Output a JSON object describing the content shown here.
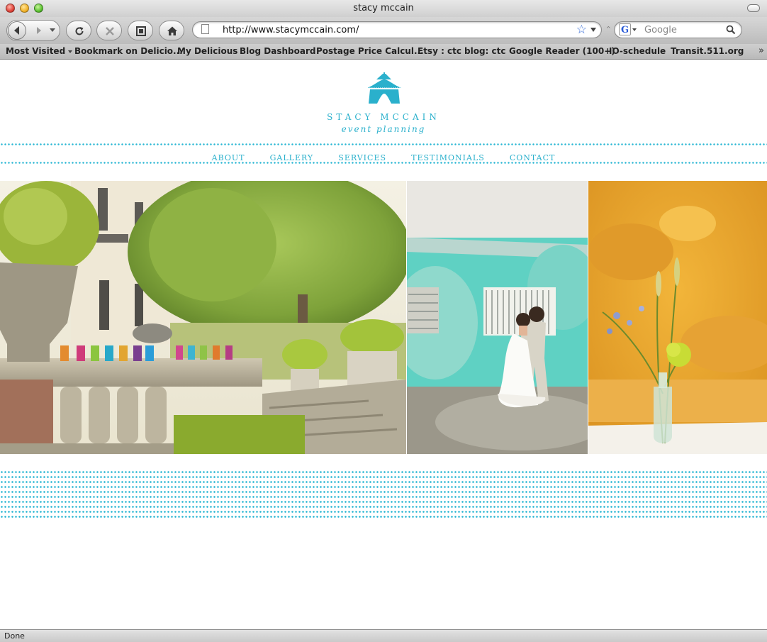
{
  "window": {
    "title": "stacy mccain"
  },
  "toolbar": {
    "url": "http://www.stacymccain.com/",
    "search_placeholder": "Google",
    "search_engine_glyph": "G"
  },
  "bookmarks": [
    "Most Visited",
    "Bookmark on Delicio...",
    "My Delicious",
    "Blog Dashboard",
    "Postage Price Calcul...",
    "Etsy : ctc",
    "blog: ctc",
    "Google Reader (100+)",
    "IO-schedule",
    "Transit.511.org"
  ],
  "site": {
    "brand_name": "STACY MCCAIN",
    "brand_tagline": "event planning",
    "accent_color": "#2ab0cc",
    "nav": [
      "ABOUT",
      "GALLERY",
      "SERVICES",
      "TESTIMONIALS",
      "CONTACT"
    ],
    "photos": [
      "garden-terrace-photo",
      "wedding-couple-photo",
      "flower-vase-photo"
    ]
  },
  "status": {
    "text": "Done"
  }
}
